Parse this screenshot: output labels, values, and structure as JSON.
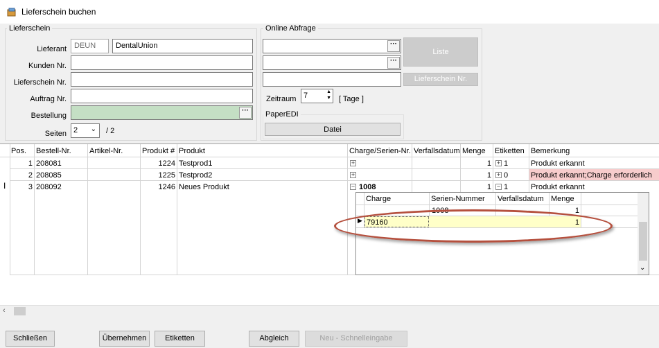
{
  "window": {
    "title": "Lieferschein buchen"
  },
  "lieferschein": {
    "group_label": "Lieferschein",
    "lieferant_label": "Lieferant",
    "lieferant_code": "DEUN",
    "lieferant_name": "DentalUnion",
    "kunden_label": "Kunden Nr.",
    "kunden_value": "",
    "lieferschein_label": "Lieferschein Nr.",
    "lieferschein_value": "",
    "auftrag_label": "Auftrag Nr.",
    "auftrag_value": "",
    "bestellung_label": "Bestellung",
    "bestellung_value": "",
    "seiten_label": "Seiten",
    "seiten_value": "2",
    "seiten_total": "/ 2"
  },
  "online": {
    "group_label": "Online Abfrage",
    "liste_button": "Liste",
    "lieferschein_button": "Lieferschein Nr.",
    "zeitraum_label": "Zeitraum",
    "zeitraum_value": "7",
    "tage_label": "[ Tage ]"
  },
  "paperedi": {
    "group_label": "PaperEDI",
    "datei_button": "Datei"
  },
  "grid": {
    "headers": [
      "Pos.",
      "Bestell-Nr.",
      "Artikel-Nr.",
      "Produkt #",
      "Produkt",
      "Charge/Serien-Nr.",
      "Verfallsdatum",
      "Menge",
      "Etiketten",
      "Bemerkung"
    ],
    "rows": [
      {
        "pos": "1",
        "bestell": "208081",
        "artikel": "",
        "produktnr": "1224",
        "produkt": "Testprod1",
        "charge": "",
        "verfall": "",
        "menge": "1",
        "etiketten": "1",
        "bemerkung": "Produkt erkannt",
        "expander": "+"
      },
      {
        "pos": "2",
        "bestell": "208085",
        "artikel": "",
        "produktnr": "1225",
        "produkt": "Testprod2",
        "charge": "",
        "verfall": "",
        "menge": "1",
        "etiketten": "0",
        "bemerkung": "Produkt erkannt;Charge erforderlich",
        "expander": "+"
      },
      {
        "pos": "3",
        "bestell": "208092",
        "artikel": "",
        "produktnr": "1246",
        "produkt": "Neues Produkt",
        "charge": "1008",
        "verfall": "",
        "menge": "1",
        "etiketten": "1",
        "bemerkung": "Produkt erkannt",
        "expander": "−"
      }
    ],
    "sub": {
      "headers": [
        "Charge",
        "Serien-Nummer",
        "Verfallsdatum",
        "Menge"
      ],
      "rows": [
        {
          "charge": "",
          "serien": "1008",
          "verfall": "",
          "menge": "1"
        },
        {
          "charge": "79160",
          "serien": "",
          "verfall": "",
          "menge": "1"
        }
      ]
    }
  },
  "footer": {
    "schliessen": "Schließen",
    "uebernehmen": "Übernehmen",
    "etiketten": "Etiketten",
    "abgleich": "Abgleich",
    "neu": "Neu - Schnelleingabe"
  },
  "colors": {
    "required_field": "#c4dfc4",
    "error_row": "#f7cccc",
    "edit_row": "#ffffc8",
    "highlight_oval": "#b5503e"
  }
}
